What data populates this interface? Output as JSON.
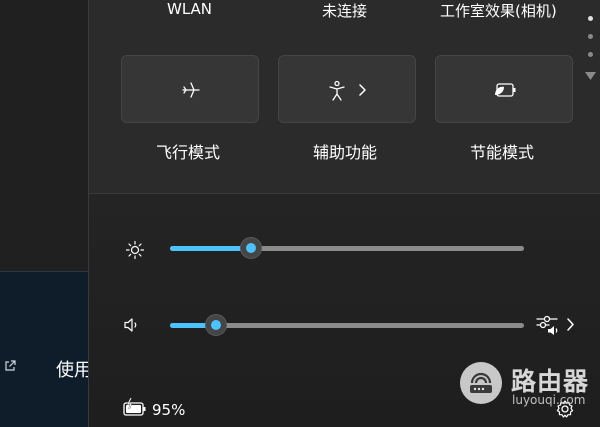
{
  "quick_settings": {
    "top_labels": [
      "WLAN",
      "未连接",
      "工作室效果(相机)"
    ],
    "tiles": [
      {
        "label": "飞行模式",
        "icon": "airplane-icon",
        "has_chevron": false
      },
      {
        "label": "辅助功能",
        "icon": "accessibility-icon",
        "has_chevron": true
      },
      {
        "label": "节能模式",
        "icon": "battery-saver-icon",
        "has_chevron": false
      }
    ],
    "page_dots": {
      "count": 3,
      "active_index": 0
    },
    "brightness": {
      "icon": "brightness-icon",
      "level": 0.23
    },
    "volume": {
      "icon": "speaker-icon",
      "level": 0.13,
      "mixer_icon": "volume-mixer-icon"
    },
    "battery": {
      "icon": "battery-charging-icon",
      "percent_text": "95%"
    },
    "settings_icon": "gear-icon"
  },
  "background": {
    "left_text": "使用"
  },
  "watermark": {
    "title": "路由器",
    "url": "luyouqi.com"
  },
  "colors": {
    "accent": "#4cc2ff",
    "panel": "#2b2b2b",
    "tile": "#363636"
  }
}
